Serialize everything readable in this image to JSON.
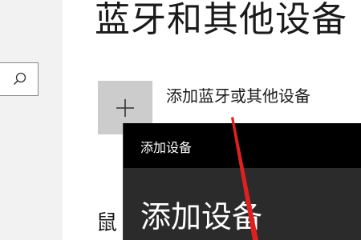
{
  "page": {
    "title": "蓝牙和其他设备"
  },
  "sidebar": {
    "search_icon": "search-icon"
  },
  "add_device": {
    "icon": "plus-icon",
    "label": "添加蓝牙或其他设备"
  },
  "section": {
    "heading_partial": "鼠"
  },
  "dialog": {
    "title": "添加设备",
    "heading": "添加设备"
  },
  "annotation": {
    "arrow_color": "#e02020"
  },
  "colors": {
    "sidebar_bg": "#f2f2f2",
    "tile_bg": "#cccccc",
    "dialog_titlebar": "#000000",
    "dialog_bg": "#2b2b2b"
  }
}
